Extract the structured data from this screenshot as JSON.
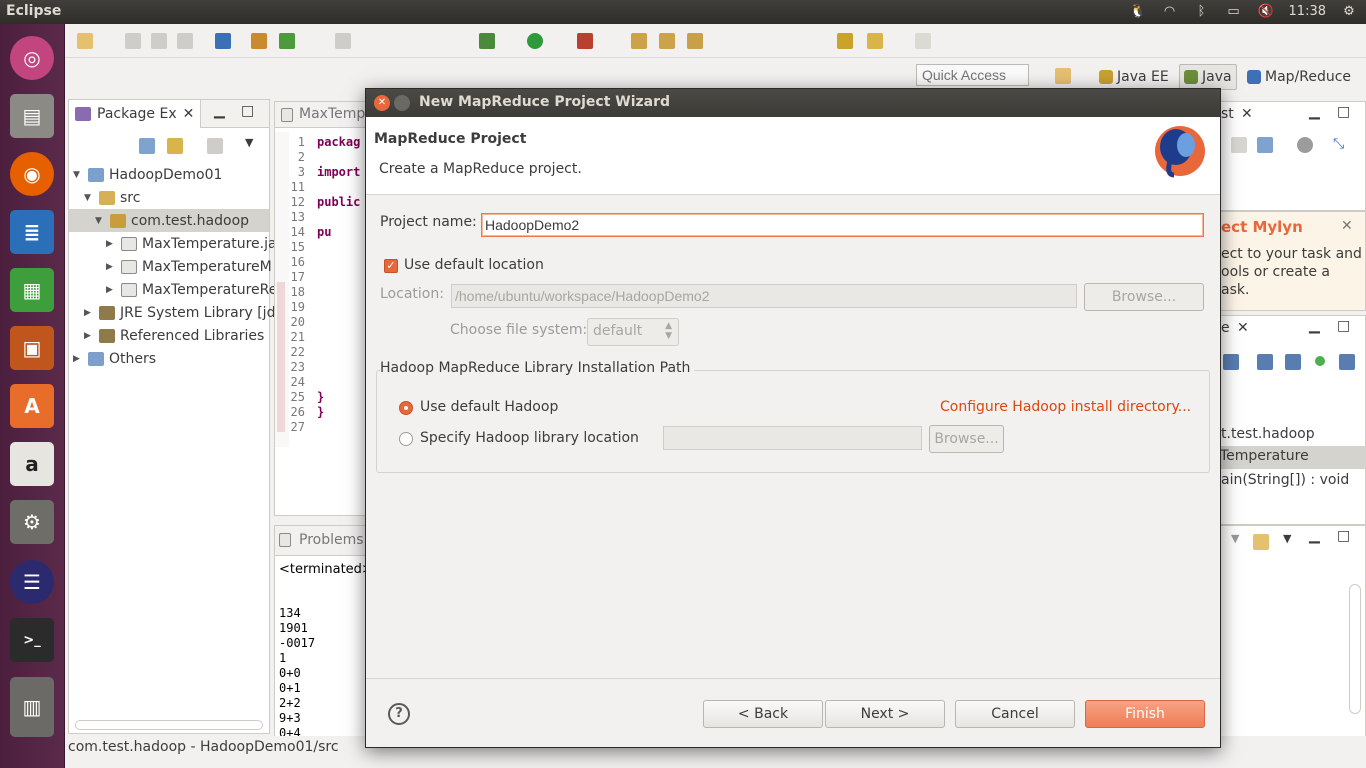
{
  "top_panel": {
    "app_title": "Eclipse",
    "clock": "11:38"
  },
  "toolbar": {
    "quick_access_placeholder": "Quick Access"
  },
  "perspectives": [
    "Java EE",
    "Java",
    "Map/Reduce"
  ],
  "package_explorer": {
    "tab_label": "Package Ex",
    "items": [
      {
        "label": "HadoopDemo01"
      },
      {
        "label": "src"
      },
      {
        "label": "com.test.hadoop"
      },
      {
        "label": "MaxTemperature.ja"
      },
      {
        "label": "MaxTemperatureM"
      },
      {
        "label": "MaxTemperatureRe"
      },
      {
        "label": "JRE System Library [jdl"
      },
      {
        "label": "Referenced Libraries"
      },
      {
        "label": "Others"
      }
    ]
  },
  "editor": {
    "tab_label": "MaxTemp",
    "lines": [
      {
        "n": "1",
        "code": "packag"
      },
      {
        "n": "2",
        "code": ""
      },
      {
        "n": "3",
        "code": "import"
      },
      {
        "n": "11",
        "code": ""
      },
      {
        "n": "12",
        "code": "public"
      },
      {
        "n": "13",
        "code": ""
      },
      {
        "n": "14",
        "code": "    pu"
      },
      {
        "n": "15",
        "code": ""
      },
      {
        "n": "16",
        "code": ""
      },
      {
        "n": "17",
        "code": ""
      },
      {
        "n": "18",
        "code": ""
      },
      {
        "n": "19",
        "code": ""
      },
      {
        "n": "20",
        "code": ""
      },
      {
        "n": "21",
        "code": ""
      },
      {
        "n": "22",
        "code": ""
      },
      {
        "n": "23",
        "code": ""
      },
      {
        "n": "24",
        "code": ""
      },
      {
        "n": "25",
        "code": "    }"
      },
      {
        "n": "26",
        "code": "}"
      },
      {
        "n": "27",
        "code": ""
      }
    ]
  },
  "console": {
    "tab_label": "Problems",
    "header": "<terminated>",
    "lines": [
      "134",
      "1901",
      "-0017",
      "1",
      "0+0",
      "0+1",
      "2+2",
      "9+3",
      "0+4"
    ]
  },
  "right_panel": {
    "task_list_tab": "st",
    "mylyn_title": "ect Mylyn",
    "mylyn_text_1": "ect to your task and",
    "mylyn_text_2": "ools or create a",
    "mylyn_text_3": "ask.",
    "outline_tab": "e",
    "outline_items": [
      "t.test.hadoop",
      "Temperature",
      "ain(String[]) : void"
    ]
  },
  "status_bar": {
    "text": "com.test.hadoop - HadoopDemo01/src"
  },
  "dialog": {
    "title": "New MapReduce Project Wizard",
    "header_title": "MapReduce Project",
    "header_desc": "Create a MapReduce project.",
    "project_name_label": "Project name:",
    "project_name_value": "HadoopDemo2",
    "use_default_location_label": "Use default location",
    "location_label": "Location:",
    "location_value": "/home/ubuntu/workspace/HadoopDemo2",
    "browse_label": "Browse...",
    "file_system_label": "Choose file system:",
    "file_system_value": "default",
    "group_title": "Hadoop MapReduce Library Installation Path",
    "use_default_hadoop_label": "Use default Hadoop",
    "configure_link": "Configure Hadoop install directory...",
    "specify_location_label": "Specify Hadoop library location",
    "browse2_label": "Browse...",
    "back_label": "< Back",
    "next_label": "Next >",
    "cancel_label": "Cancel",
    "finish_label": "Finish"
  }
}
